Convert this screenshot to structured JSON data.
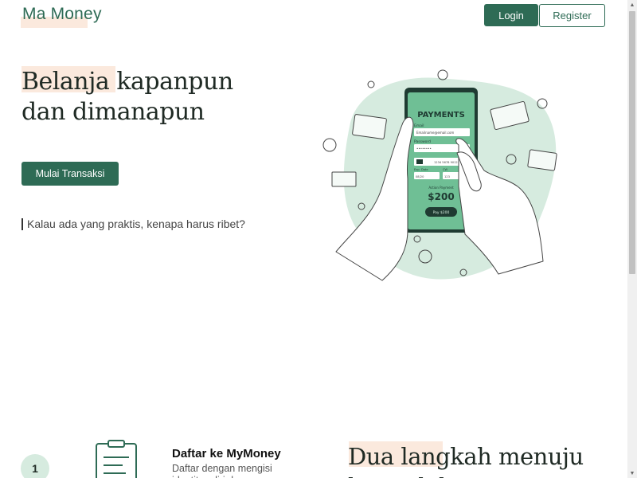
{
  "header": {
    "brand": "Ma Money",
    "login_label": "Login",
    "register_label": "Register"
  },
  "hero": {
    "title_line1": "Belanja kapanpun",
    "title_line2": "dan dimanapun",
    "cta_label": "Mulai Transaksi",
    "tagline": "Kalau ada yang praktis, kenapa harus ribet?"
  },
  "illustration": {
    "phone_header": "PAYMENTS",
    "email_label": "Email",
    "email_placeholder": "Emailname@email.com",
    "password_label": "Password",
    "password_value": "••••••••",
    "card_number": "1234 5678 9012",
    "expiry_label": "Exp. Date",
    "expiry_value": "08/20",
    "cvv_label": "CW",
    "cvv_value": "123",
    "amount_label": "Action Payment",
    "amount": "$200",
    "pay_button": "Pay $200"
  },
  "steps": {
    "number": "1",
    "title": "Daftar ke MyMoney",
    "description": "Daftar dengan mengisi identitas diri dan cara"
  },
  "section": {
    "title_line1": "Dua langkah menuju",
    "title_line2": "kemudahan"
  },
  "colors": {
    "primary": "#2e6b55",
    "highlight": "#fbe9dd",
    "blob": "#d6ebdf"
  },
  "icons": {
    "scroll_up": "▲",
    "scroll_down": "▼"
  }
}
